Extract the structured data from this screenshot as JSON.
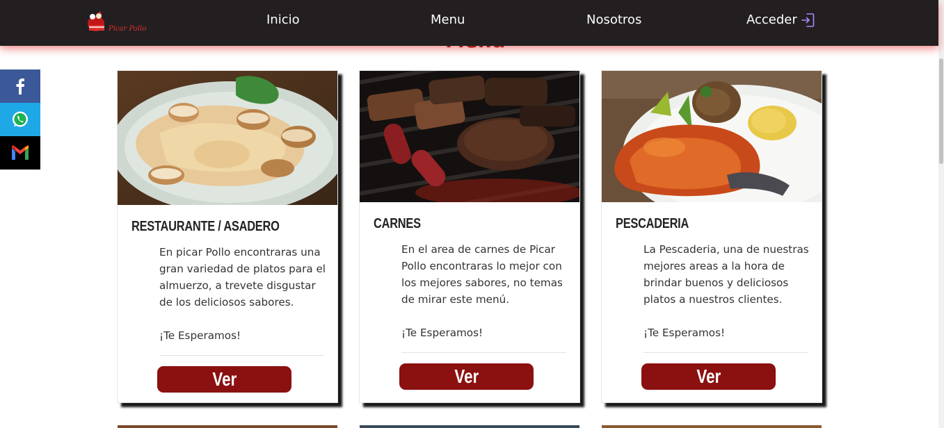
{
  "navbar": {
    "logo_alt": "Picar Pollo",
    "links": [
      {
        "label": "Inicio"
      },
      {
        "label": "Menu"
      },
      {
        "label": "Nosotros"
      },
      {
        "label": "Acceder"
      }
    ]
  },
  "section": {
    "title": "Menu"
  },
  "social": [
    {
      "name": "facebook",
      "icon": "facebook-icon",
      "color": "#3b5998"
    },
    {
      "name": "whatsapp",
      "icon": "whatsapp-icon",
      "color": "#1fa8e6"
    },
    {
      "name": "gmail",
      "icon": "gmail-icon",
      "color": "#000000"
    }
  ],
  "cards": [
    {
      "title": "RESTAURANTE / ASADERO",
      "text": "En picar Pollo encontraras una gran variedad de platos para el almuerzo, a trevete disgustar de los deliciosos sabores.",
      "greeting": "¡Te Esperamos!",
      "button": "Ver",
      "image": "chicken-mushroom-dish"
    },
    {
      "title": "CARNES",
      "text": "En el area de carnes de Picar Pollo encontraras lo mejor con los mejores sabores, no temas de mirar este menú.",
      "greeting": "¡Te Esperamos!",
      "button": "Ver",
      "image": "grilled-meats"
    },
    {
      "title": "PESCADERIA",
      "text": "La Pescaderia, una de nuestras mejores areas a la hora de brindar buenos y deliciosos platos a nuestros clientes.",
      "greeting": "¡Te Esperamos!",
      "button": "Ver",
      "image": "fish-plate"
    }
  ],
  "colors": {
    "navbar": "#231f20",
    "accent": "#8b1010",
    "nav_glow": "#e62828"
  }
}
